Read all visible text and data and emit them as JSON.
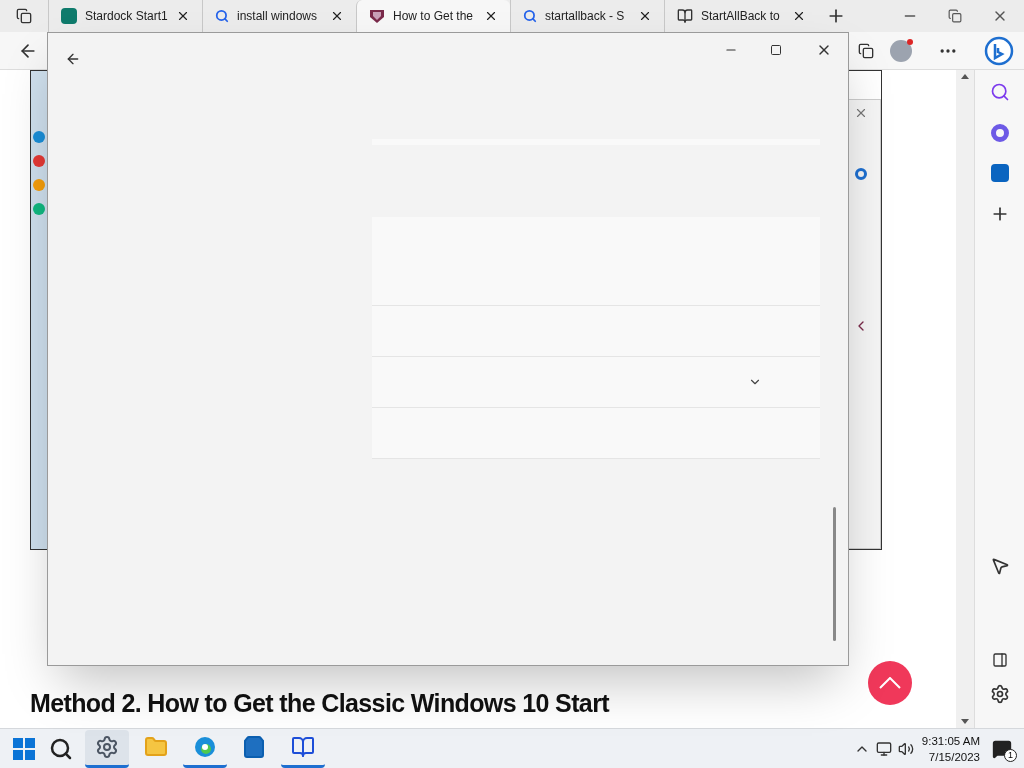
{
  "browser": {
    "tabs": [
      {
        "title": "Stardock Start1",
        "kind": "forms",
        "selected": false
      },
      {
        "title": "install windows",
        "kind": "search",
        "selected": false
      },
      {
        "title": "How to Get the",
        "kind": "shield",
        "selected": true
      },
      {
        "title": "startallback - S",
        "kind": "search",
        "selected": false
      },
      {
        "title": "StartAllBack to",
        "kind": "book",
        "selected": false
      }
    ]
  },
  "article": {
    "heading": "Method 2. How to Get the Classic Windows 10 Start"
  },
  "settings_window": {
    "rows": [
      {
        "kind": "card"
      },
      {
        "kind": "row"
      },
      {
        "kind": "dropdown"
      },
      {
        "kind": "row"
      }
    ]
  },
  "taskbar": {
    "apps": [
      {
        "kind": "settings",
        "running": true,
        "active": true
      },
      {
        "kind": "folder",
        "running": false,
        "active": false
      },
      {
        "kind": "edge",
        "running": true,
        "active": false
      },
      {
        "kind": "store",
        "running": false,
        "active": false
      },
      {
        "kind": "notebook",
        "running": true,
        "active": false
      }
    ],
    "time": "9:31:05 AM",
    "date": "7/15/2023",
    "notifications": "1"
  }
}
